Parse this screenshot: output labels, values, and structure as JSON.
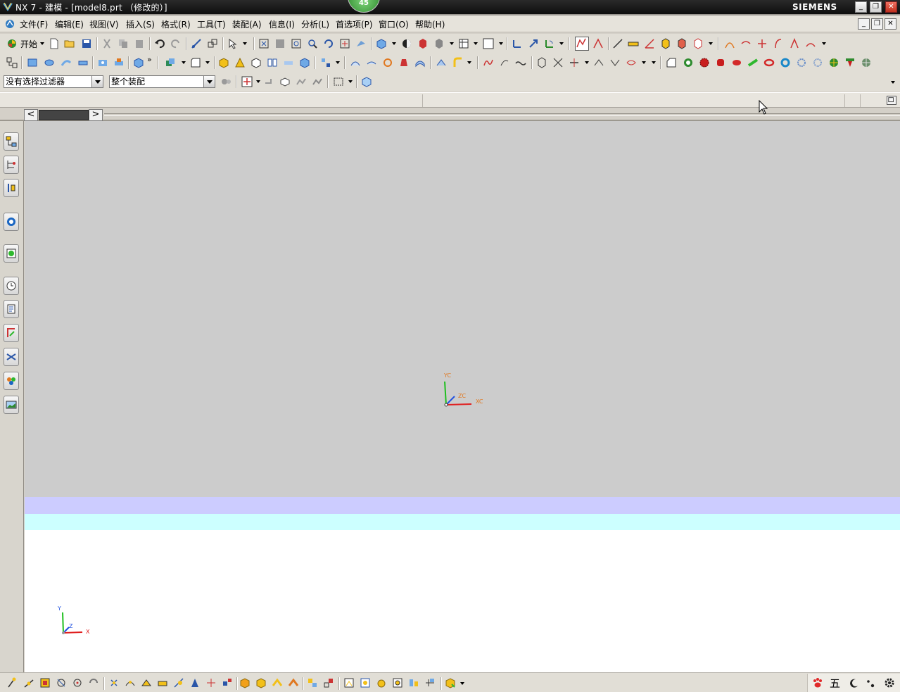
{
  "window": {
    "title": "NX 7 - 建模 - [model8.prt （修改的）]",
    "notification_count": "45",
    "brand": "SIEMENS",
    "controls": {
      "minimize": "_",
      "restore": "❐",
      "close": "✕"
    }
  },
  "menubar": {
    "items": [
      {
        "label": "开始",
        "name": "start"
      },
      {
        "label": "文件(F)",
        "name": "file"
      },
      {
        "label": "编辑(E)",
        "name": "edit"
      },
      {
        "label": "视图(V)",
        "name": "view"
      },
      {
        "label": "插入(S)",
        "name": "insert"
      },
      {
        "label": "格式(R)",
        "name": "format"
      },
      {
        "label": "工具(T)",
        "name": "tools"
      },
      {
        "label": "装配(A)",
        "name": "assembly"
      },
      {
        "label": "信息(I)",
        "name": "information"
      },
      {
        "label": "分析(L)",
        "name": "analysis"
      },
      {
        "label": "首选项(P)",
        "name": "preferences"
      },
      {
        "label": "窗口(O)",
        "name": "window"
      },
      {
        "label": "帮助(H)",
        "name": "help"
      }
    ]
  },
  "toolbar_start_label": "开始",
  "selection_bar": {
    "filter_value": "没有选择过滤器",
    "scope_value": "整个装配"
  },
  "viewport": {
    "wcs_labels": {
      "yc": "YC",
      "zc": "ZC",
      "xc": "XC"
    },
    "abs_labels": {
      "y": "Y",
      "z": "Z",
      "x": "X"
    },
    "colors": {
      "background": "#cccccc",
      "band_lavender": "#ccccff",
      "band_cyan": "#ccffff",
      "lower": "#ffffff"
    }
  },
  "statusbar": {
    "ime_label": "五"
  }
}
